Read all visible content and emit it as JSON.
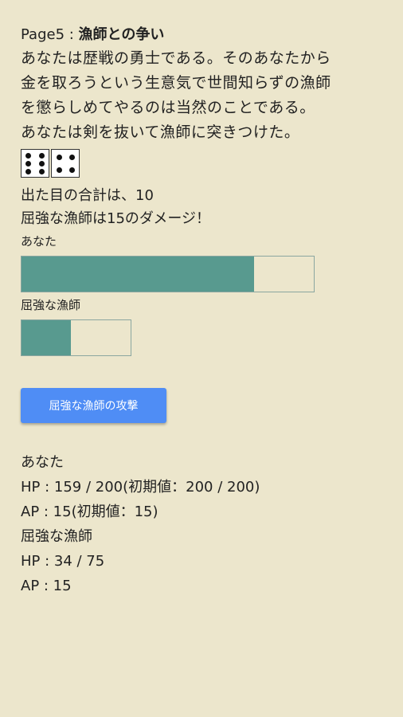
{
  "header": {
    "page_label": "Page5 : ",
    "title": "漁師との争い"
  },
  "story": {
    "lines": [
      "あなたは歴戦の勇士である。そのあなたから",
      "金を取ろうという生意気で世間知らずの漁師",
      "を懲らしめてやるのは当然のことである。",
      "あなたは剣を抜いて漁師に突きつけた。"
    ]
  },
  "dice": {
    "values": [
      6,
      4
    ]
  },
  "result": {
    "sum_line": "出た目の合計は、10",
    "damage_line": "屈強な漁師は15のダメージ！"
  },
  "bars": {
    "you": {
      "label": "あなた",
      "hp": 159,
      "hp_max": 200,
      "fill_fraction": 0.795
    },
    "enemy": {
      "label": "屈強な漁師",
      "hp": 34,
      "hp_max": 75,
      "fill_fraction": 0.453
    }
  },
  "action": {
    "button_label": "屈強な漁師の攻撃"
  },
  "stats": {
    "you_name": "あなた",
    "you_hp": "HP : 159 / 200(初期値：200 / 200)",
    "you_ap": "AP : 15(初期値：15)",
    "enemy_name": "屈強な漁師",
    "enemy_hp": "HP : 34 / 75",
    "enemy_ap": "AP : 15"
  },
  "colors": {
    "background": "#ece6cc",
    "bar_fill": "#589a8f",
    "button": "#4f8df5"
  }
}
